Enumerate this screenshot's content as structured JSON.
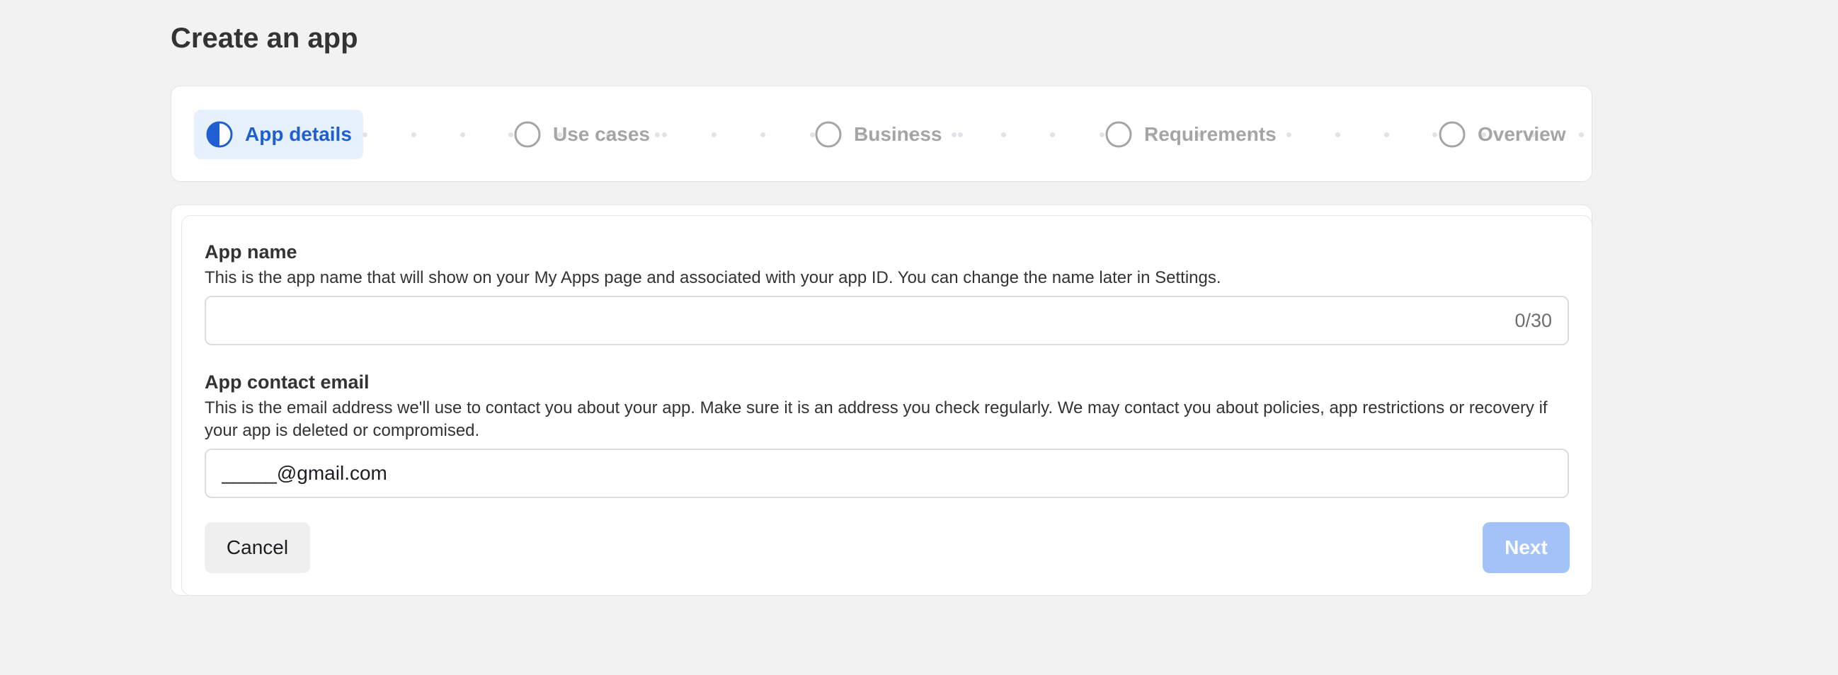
{
  "page": {
    "title": "Create an app"
  },
  "stepper": {
    "steps": [
      {
        "label": "App details",
        "state": "in-progress"
      },
      {
        "label": "Use cases",
        "state": "pending"
      },
      {
        "label": "Business",
        "state": "pending"
      },
      {
        "label": "Requirements",
        "state": "pending"
      },
      {
        "label": "Overview",
        "state": "pending"
      }
    ]
  },
  "form": {
    "app_name": {
      "label": "App name",
      "help": "This is the app name that will show on your My Apps page and associated with your app ID. You can change the name later in Settings.",
      "value": "",
      "counter": "0/30"
    },
    "contact_email": {
      "label": "App contact email",
      "help": "This is the email address we'll use to contact you about your app. Make sure it is an address you check regularly. We may contact you about policies, app restrictions or recovery if your app is deleted or compromised.",
      "value": "_____@gmail.com"
    },
    "cancel_label": "Cancel",
    "next_label": "Next"
  },
  "colors": {
    "accent": "#1f5fd1",
    "active_step_bg": "#e7f0fd",
    "next_disabled_bg": "#a3c3f8",
    "inactive_step": "#a5a5a5",
    "page_bg": "#f2f2f2"
  },
  "icons": {
    "step_in_progress": "half-filled-circle-icon",
    "step_pending": "empty-circle-icon"
  }
}
